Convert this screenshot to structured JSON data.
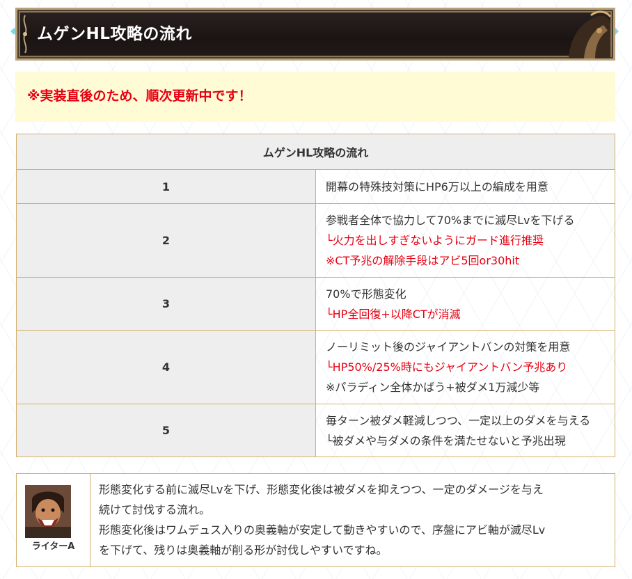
{
  "banner": {
    "title": "ムゲンHL攻略の流れ"
  },
  "notice": {
    "text": "※実装直後のため、順次更新中です！"
  },
  "table": {
    "header": "ムゲンHL攻略の流れ",
    "rows": [
      {
        "num": "1",
        "lines": [
          {
            "text": "開幕の特殊技対策にHP6万以上の編成を用意",
            "red": false
          }
        ]
      },
      {
        "num": "2",
        "lines": [
          {
            "text": "参戦者全体で協力して70%までに滅尽Lvを下げる",
            "red": false
          },
          {
            "text": "└火力を出しすぎないようにガード進行推奨",
            "red": true
          },
          {
            "text": "※CT予兆の解除手段はアビ5回or30hit",
            "red": true
          }
        ]
      },
      {
        "num": "3",
        "lines": [
          {
            "text": "70%で形態変化",
            "red": false
          },
          {
            "text": "└HP全回復+以降CTが消滅",
            "red": true
          }
        ]
      },
      {
        "num": "4",
        "lines": [
          {
            "text": "ノーリミット後のジャイアントバンの対策を用意",
            "red": false
          },
          {
            "text": "└HP50%/25%時にもジャイアントバン予兆あり",
            "red": true
          },
          {
            "text": "※パラディン全体かばう+被ダメ1万減少等",
            "red": false
          }
        ]
      },
      {
        "num": "5",
        "lines": [
          {
            "text": "毎ターン被ダメ軽減しつつ、一定以上のダメを与える",
            "red": false
          },
          {
            "text": "└被ダメや与ダメの条件を満たせないと予兆出現",
            "red": false
          }
        ]
      }
    ]
  },
  "speaker": {
    "name": "ライターA",
    "lines": [
      "形態変化する前に滅尽Lvを下げ、形態変化後は被ダメを抑えつつ、一定のダメージを与え",
      "続けて討伐する流れ。",
      "形態変化後はワムデュス入りの奥義軸が安定して動きやすいので、序盤にアビ軸が滅尽Lv",
      "を下げて、残りは奥義軸が削る形が討伐しやすいですね。"
    ]
  },
  "colors": {
    "accent_red": "#e60012",
    "table_border": "#d4ae6a",
    "notice_bg": "#fffbd4"
  }
}
